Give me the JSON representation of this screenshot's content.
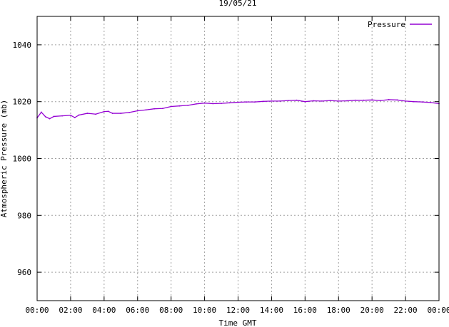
{
  "chart_data": {
    "type": "line",
    "title": "19/05/21",
    "xlabel": "Time GMT",
    "ylabel": "Atmospheric Pressure (mb)",
    "ylim": [
      950,
      1050
    ],
    "xlim": [
      0,
      24
    ],
    "grid": true,
    "legend_position": "top-right",
    "x_tick_labels": [
      "00:00",
      "02:00",
      "04:00",
      "06:00",
      "08:00",
      "10:00",
      "12:00",
      "14:00",
      "16:00",
      "18:00",
      "20:00",
      "22:00",
      "00:00"
    ],
    "y_ticks": [
      960,
      980,
      1000,
      1020,
      1040
    ],
    "series": [
      {
        "name": "Pressure",
        "color": "#9400d3",
        "x": [
          0,
          0.25,
          0.5,
          0.75,
          1,
          1.5,
          2,
          2.25,
          2.5,
          3,
          3.5,
          4,
          4.25,
          4.5,
          5,
          5.5,
          6,
          6.5,
          7,
          7.5,
          8,
          8.5,
          9,
          9.5,
          10,
          10.5,
          11,
          11.5,
          12,
          12.5,
          13,
          13.5,
          14,
          14.5,
          15,
          15.5,
          16,
          16.5,
          17,
          17.5,
          18,
          18.5,
          19,
          19.5,
          20,
          20.5,
          21,
          21.5,
          22,
          22.5,
          23,
          23.5,
          24
        ],
        "y": [
          1014.3,
          1016.3,
          1014.7,
          1014.0,
          1014.8,
          1015.0,
          1015.2,
          1014.4,
          1015.3,
          1015.9,
          1015.6,
          1016.5,
          1016.6,
          1015.9,
          1015.9,
          1016.2,
          1016.8,
          1017.1,
          1017.5,
          1017.6,
          1018.3,
          1018.5,
          1018.7,
          1019.2,
          1019.5,
          1019.3,
          1019.4,
          1019.6,
          1019.8,
          1019.9,
          1019.9,
          1020.1,
          1020.2,
          1020.2,
          1020.4,
          1020.5,
          1020.0,
          1020.3,
          1020.2,
          1020.4,
          1020.2,
          1020.3,
          1020.5,
          1020.5,
          1020.6,
          1020.4,
          1020.7,
          1020.6,
          1020.2,
          1020.0,
          1019.9,
          1019.7,
          1019.3
        ]
      }
    ]
  }
}
